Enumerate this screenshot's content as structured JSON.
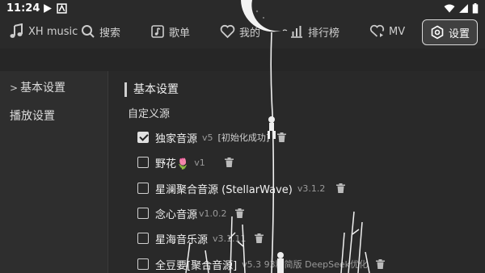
{
  "status": {
    "time": "11:24",
    "battery": "100%"
  },
  "nav": {
    "app_name": "XH music",
    "search": "搜索",
    "playlist": "歌单",
    "favorites": "我的",
    "chart": "排行榜",
    "mv": "MV",
    "settings": "设置"
  },
  "sidebar": {
    "items": [
      {
        "label": "基本设置",
        "marker": ">"
      },
      {
        "label": "播放设置"
      }
    ]
  },
  "main": {
    "section_title": "基本设置",
    "subsection_title": "自定义源",
    "sources": [
      {
        "name": "独家音源",
        "version": "v5",
        "extra": "[初始化成功]",
        "checked": true
      },
      {
        "name": "野花🌷",
        "version": "v1",
        "checked": false
      },
      {
        "name": "星澜聚合音源 (StellarWave)",
        "version": "v3.1.2",
        "checked": false
      },
      {
        "name": "念心音源",
        "version": "v1.0.2",
        "checked": false
      },
      {
        "name": "星海音乐源",
        "version": "v3.1.11",
        "checked": false
      },
      {
        "name": "全豆要[聚合音源]",
        "version": "v5.3 93精简版 DeepSeek优化",
        "checked": false
      }
    ]
  },
  "colors": {
    "accent": "#d8d8d8",
    "background": "#2a2a2a"
  }
}
